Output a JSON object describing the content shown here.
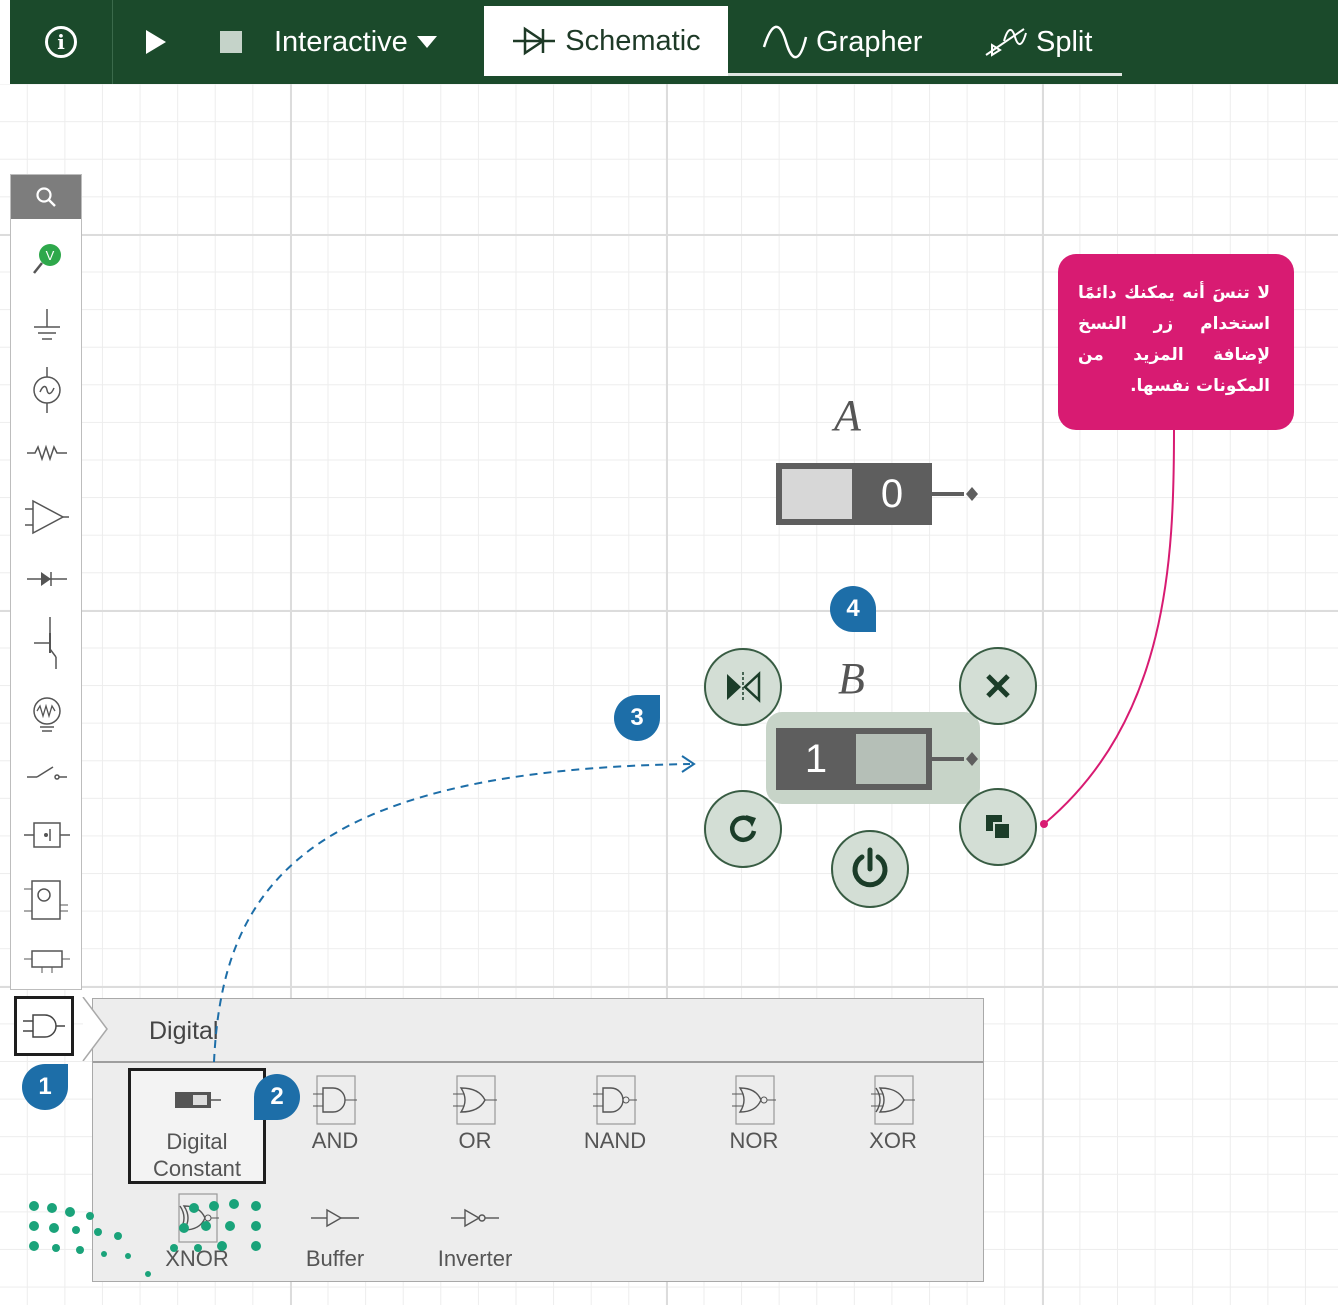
{
  "toolbar": {
    "mode_label": "Interactive",
    "tabs": [
      {
        "label": "Schematic",
        "active": true
      },
      {
        "label": "Grapher"
      },
      {
        "label": "Split"
      }
    ]
  },
  "canvas": {
    "component_a": {
      "label": "A",
      "value": "0"
    },
    "component_b": {
      "label": "B",
      "value": "1"
    }
  },
  "subpanel": {
    "title": "Digital",
    "items": [
      {
        "label": "Digital Constant"
      },
      {
        "label": "AND"
      },
      {
        "label": "OR"
      },
      {
        "label": "NAND"
      },
      {
        "label": "NOR"
      },
      {
        "label": "XOR"
      },
      {
        "label": "XNOR"
      },
      {
        "label": "Buffer"
      },
      {
        "label": "Inverter"
      }
    ]
  },
  "badges": [
    "1",
    "2",
    "3",
    "4"
  ],
  "callout": {
    "text": "لا تنسَ أنه يمكنك دائمًا استخدام زر النسخ لإضافة المزيد من المكونات نفسها."
  },
  "colors": {
    "toolbar_bg": "#1b4a2b",
    "badge": "#1d6ea8",
    "callout": "#d81b72",
    "selection": "#c7d4c8"
  }
}
